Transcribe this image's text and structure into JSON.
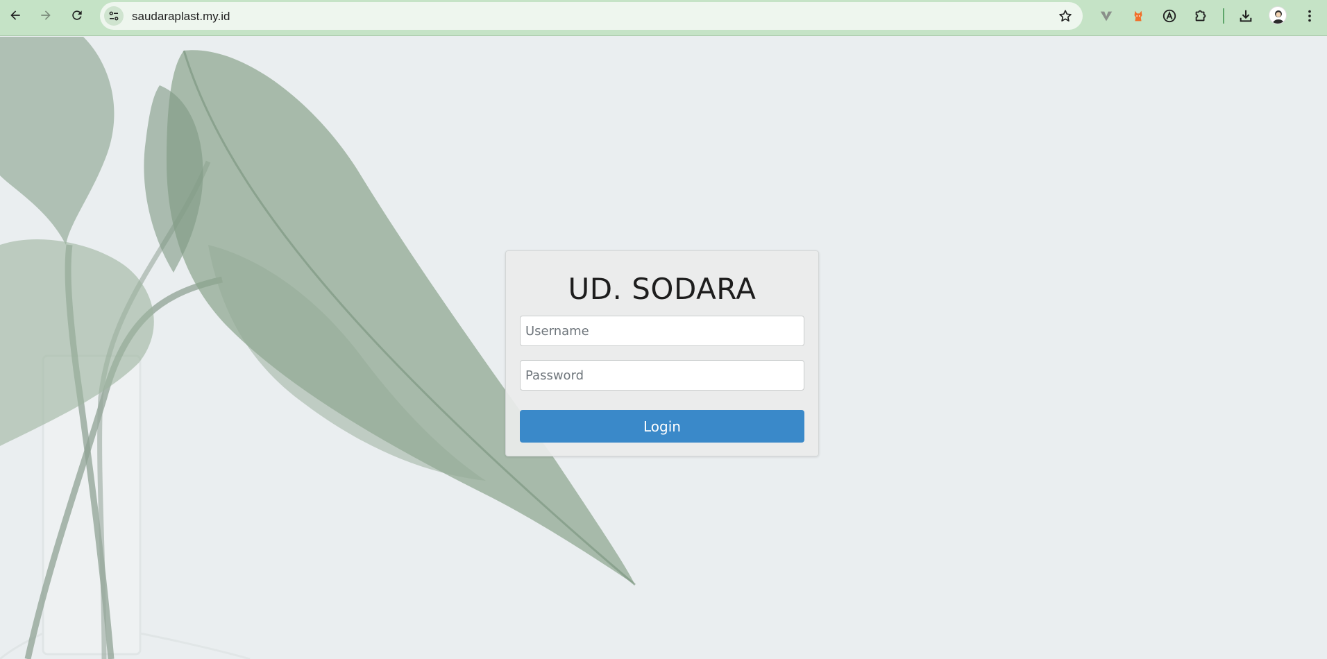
{
  "browser": {
    "url": "saudaraplast.my.id",
    "icons": {
      "back": "arrow-left-icon",
      "forward": "arrow-right-icon",
      "reload": "reload-icon",
      "site_info": "tune-icon",
      "bookmark": "star-icon",
      "extensions": [
        "v-extension-icon",
        "fox-extension-icon",
        "atom-extension-icon",
        "puzzle-icon"
      ],
      "downloads": "download-icon",
      "profile": "avatar-icon",
      "menu": "kebab-menu-icon"
    }
  },
  "login": {
    "title": "UD. SODARA",
    "username_placeholder": "Username",
    "password_placeholder": "Password",
    "button_label": "Login"
  },
  "colors": {
    "toolbar": "#c5e3c6",
    "button": "#3a89c9",
    "page_bg": "#eaeef0"
  }
}
